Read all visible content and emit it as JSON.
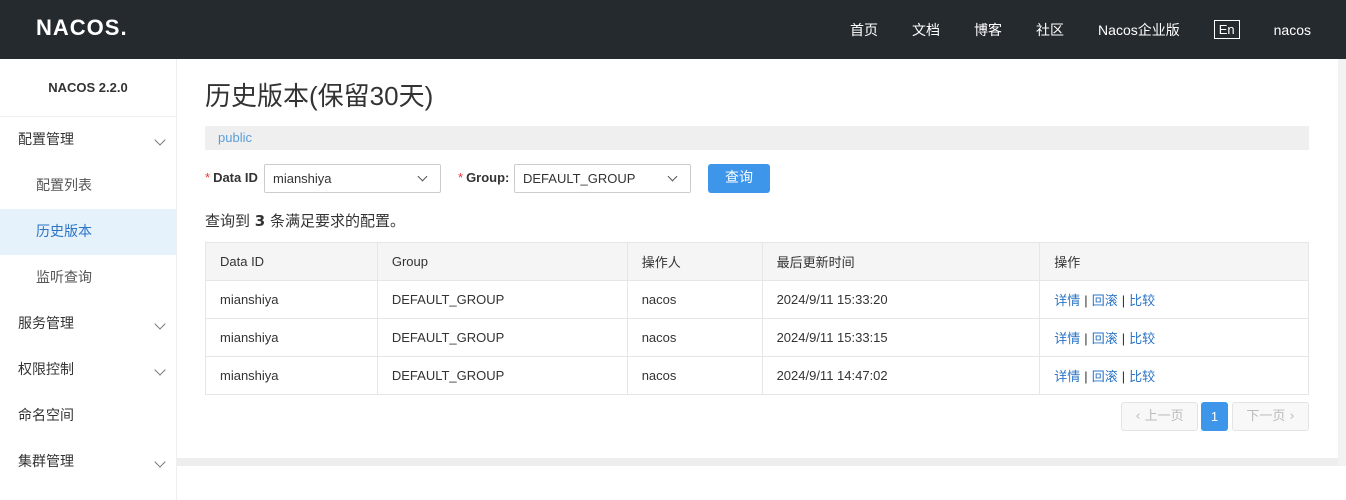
{
  "header": {
    "logo": "NACOS.",
    "nav": [
      "首页",
      "文档",
      "博客",
      "社区",
      "Nacos企业版"
    ],
    "lang": "En",
    "user": "nacos"
  },
  "sidebar": {
    "version": "NACOS 2.2.0",
    "items": [
      {
        "label": "配置管理",
        "type": "group"
      },
      {
        "label": "配置列表",
        "type": "sub"
      },
      {
        "label": "历史版本",
        "type": "sub",
        "active": true
      },
      {
        "label": "监听查询",
        "type": "sub"
      },
      {
        "label": "服务管理",
        "type": "group"
      },
      {
        "label": "权限控制",
        "type": "group"
      },
      {
        "label": "命名空间",
        "type": "leaf"
      },
      {
        "label": "集群管理",
        "type": "group"
      }
    ]
  },
  "main": {
    "title": "历史版本(保留30天)",
    "namespace": "public",
    "form": {
      "data_id_label": "Data ID",
      "data_id_value": "mianshiya",
      "group_label": "Group:",
      "group_value": "DEFAULT_GROUP",
      "query_button": "查询"
    },
    "result": {
      "prefix": "查询到",
      "count": "3",
      "suffix": "条满足要求的配置。"
    },
    "table": {
      "headers": [
        "Data ID",
        "Group",
        "操作人",
        "最后更新时间",
        "操作"
      ],
      "rows": [
        {
          "data_id": "mianshiya",
          "group": "DEFAULT_GROUP",
          "operator": "nacos",
          "time": "2024/9/11 15:33:20"
        },
        {
          "data_id": "mianshiya",
          "group": "DEFAULT_GROUP",
          "operator": "nacos",
          "time": "2024/9/11 15:33:15"
        },
        {
          "data_id": "mianshiya",
          "group": "DEFAULT_GROUP",
          "operator": "nacos",
          "time": "2024/9/11 14:47:02"
        }
      ],
      "actions": {
        "detail": "详情",
        "rollback": "回滚",
        "compare": "比较"
      }
    },
    "pager": {
      "prev": "上一页",
      "current": "1",
      "next": "下一页"
    }
  },
  "colors": {
    "topbar": "#252a2f",
    "primary": "#3e96ea",
    "link": "#2b74c6",
    "active_bg": "#e5f1fb"
  }
}
